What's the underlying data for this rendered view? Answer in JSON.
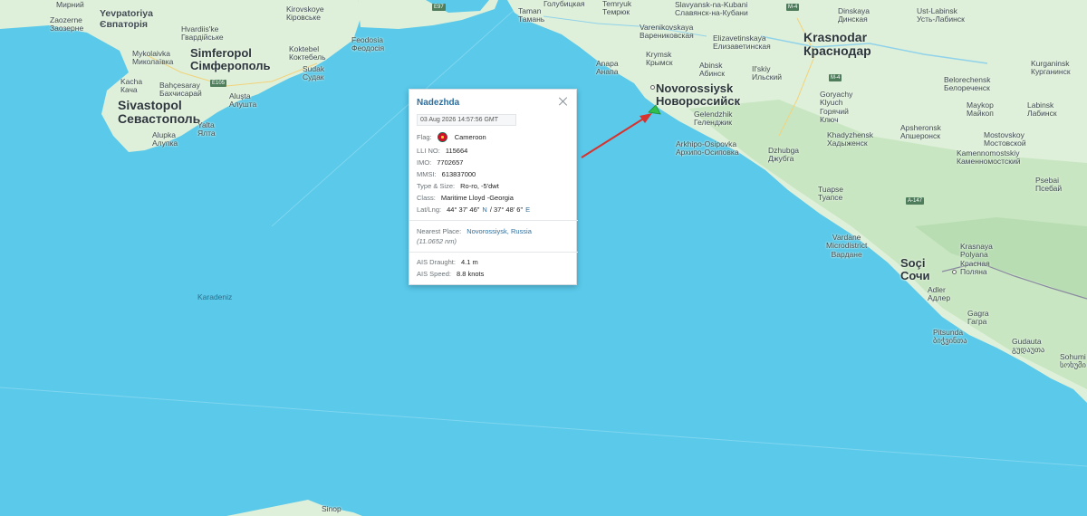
{
  "map": {
    "sea_label": "Karadeniz",
    "labels": [
      {
        "id": "zaozerne",
        "text": "Zaozerne\nЗаозерне",
        "cls": "sm"
      },
      {
        "id": "yevpatoriya",
        "text": "Yevpatoriya\nЄвпаторія",
        "cls": "md"
      },
      {
        "id": "mirnyi",
        "text": "Мирний",
        "cls": "sm"
      },
      {
        "id": "hvardiiske",
        "text": "Hvardiis'ke\nГвардійське",
        "cls": "sm"
      },
      {
        "id": "mykolaivka",
        "text": "Mykolaivka\nМиколаївка",
        "cls": "sm"
      },
      {
        "id": "simferopol",
        "text": "Simferopol\nСімферополь",
        "cls": "lg"
      },
      {
        "id": "kacha",
        "text": "Kacha\nКача",
        "cls": "sm"
      },
      {
        "id": "bahcesaray",
        "text": "Bahçesaray\nБахчисарай",
        "cls": "sm"
      },
      {
        "id": "sivastopol",
        "text": "Sivastopol\nСевастополь",
        "cls": "xl"
      },
      {
        "id": "alushta",
        "text": "Alușta\nАлушта",
        "cls": "sm"
      },
      {
        "id": "yalta",
        "text": "Yalta\nЯлта",
        "cls": "sm"
      },
      {
        "id": "alupka",
        "text": "Alupka\nАлупка",
        "cls": "sm"
      },
      {
        "id": "kirovskoye",
        "text": "Kirovskoye\nКіровське",
        "cls": "sm"
      },
      {
        "id": "koktebel",
        "text": "Koktebel\nКоктебель",
        "cls": "sm"
      },
      {
        "id": "feodosia",
        "text": "Feodosia\nФеодосія",
        "cls": "sm"
      },
      {
        "id": "sudak",
        "text": "Sudak\nСудак",
        "cls": "sm"
      },
      {
        "id": "taman",
        "text": "Taman\nТамань",
        "cls": "sm"
      },
      {
        "id": "golubitskaya",
        "text": "Голубицкая",
        "cls": "sm"
      },
      {
        "id": "temryuk",
        "text": "Temryuk\nТемрюк",
        "cls": "sm"
      },
      {
        "id": "slavyansk",
        "text": "Slavyansk-na-Kubani\nСлавянск-на-Кубани",
        "cls": "sm"
      },
      {
        "id": "varenikovskaya",
        "text": "Varenikovskaya\nВарениковская",
        "cls": "sm"
      },
      {
        "id": "krymsk",
        "text": "Krymsk\nКрымск",
        "cls": "sm"
      },
      {
        "id": "anapa",
        "text": "Anapa\nАнапа",
        "cls": "sm"
      },
      {
        "id": "abinsk",
        "text": "Abinsk\nАбинск",
        "cls": "sm"
      },
      {
        "id": "ilsky",
        "text": "Il'skiy\nИльский",
        "cls": "sm"
      },
      {
        "id": "elizavetinskaya",
        "text": "Elizavetinskaya\nЕлизаветинская",
        "cls": "sm"
      },
      {
        "id": "krasnodar",
        "text": "Krasnodar\nКраснодар",
        "cls": "xl"
      },
      {
        "id": "dinskaya",
        "text": "Dinskaya\nДинская",
        "cls": "sm"
      },
      {
        "id": "ustlabinsk",
        "text": "Ust-Labinsk\nУсть-Лабинск",
        "cls": "sm"
      },
      {
        "id": "novorossiysk",
        "text": "Novorossiysk\nНовороссийск",
        "cls": "lg"
      },
      {
        "id": "gelendzhik",
        "text": "Gelendzhik\nГеленджик",
        "cls": "sm"
      },
      {
        "id": "arkhipo",
        "text": "Arkhipo-Osipovka\nАрхипо-Осиповка",
        "cls": "sm"
      },
      {
        "id": "dzhubga",
        "text": "Dzhubga\nДжубга",
        "cls": "sm"
      },
      {
        "id": "goryachy",
        "text": "Goryachy\nKlyuch\nГорячий\nКлюч",
        "cls": "sm"
      },
      {
        "id": "beloreshensk",
        "text": "Belorechensk\nБелореченск",
        "cls": "sm"
      },
      {
        "id": "kurganinsk",
        "text": "Kurganinsk\nКурганинск",
        "cls": "sm"
      },
      {
        "id": "labinsk",
        "text": "Labinsk\nЛабинск",
        "cls": "sm"
      },
      {
        "id": "maykop",
        "text": "Маykop\nМайкоп",
        "cls": "sm"
      },
      {
        "id": "khadyzhensk",
        "text": "Khadyzhensk\nХадыженск",
        "cls": "sm"
      },
      {
        "id": "apsheronsk",
        "text": "Apsheronsk\nАпшеронск",
        "cls": "sm"
      },
      {
        "id": "mostovskoy",
        "text": "Mostovskoy\nМостовской",
        "cls": "sm"
      },
      {
        "id": "kamennomostsky",
        "text": "Kamennomostskiy\nКаменномостский",
        "cls": "sm"
      },
      {
        "id": "tuapse",
        "text": "Tuapse\nТуапсе",
        "cls": "sm"
      },
      {
        "id": "psebai",
        "text": "Psebai\nПсебай",
        "cls": "sm"
      },
      {
        "id": "vardane",
        "text": "Vardane\nMicrodistrict\nВардане",
        "cls": "sm"
      },
      {
        "id": "sochi",
        "text": "Soçi\nСочи",
        "cls": "lg"
      },
      {
        "id": "krasnaya",
        "text": "Krasnaya\nPolyana\nКрасная\nПоляна",
        "cls": "sm"
      },
      {
        "id": "adler",
        "text": "Adler\nАдлер",
        "cls": "sm"
      },
      {
        "id": "gagra",
        "text": "Gagra\nГагра",
        "cls": "sm"
      },
      {
        "id": "pitsunda",
        "text": "Pitsunda\nბიჭვინთა",
        "cls": "sm"
      },
      {
        "id": "gudauta",
        "text": "Gudauta\nგუდაუთა",
        "cls": "sm"
      },
      {
        "id": "sohumi",
        "text": "Sohumi\nსოხუმი",
        "cls": "sm"
      },
      {
        "id": "sinop",
        "text": "Sinop",
        "cls": "sm"
      }
    ],
    "road_badges": [
      "E105",
      "E97",
      "M-4",
      "M-4",
      "A-147"
    ]
  },
  "popup": {
    "title": "Nadezhda",
    "timestamp": "03 Aug 2026 14:57:56 GMT",
    "flag_label": "Flag:",
    "flag_value": "Cameroon",
    "lli_label": "LLI NO:",
    "lli_value": "115664",
    "imo_label": "IMO:",
    "imo_value": "7702657",
    "mmsi_label": "MMSI:",
    "mmsi_value": "613837000",
    "type_label": "Type & Size:",
    "type_value": "Ro-ro, -5'dwt",
    "class_label": "Class:",
    "class_value": "Maritime Lloyd -Georgia",
    "latlng_label": "Lat/Lng:",
    "lat_value": "44° 37' 46\"",
    "lat_dir": "N",
    "lng_value": "/ 37° 48' 6\"",
    "lng_dir": "E",
    "nearest_label": "Nearest Place:",
    "nearest_value": "Novorossiysk, Russia",
    "nearest_distance": "(11.0652 nm)",
    "draught_label": "AIS Draught:",
    "draught_value": "4.1 m",
    "speed_label": "AIS Speed:",
    "speed_value": "8.8 knots"
  },
  "colors": {
    "sea": "#5ac9ea",
    "land": "#dff0da",
    "arrow": "#d8322f",
    "vessel": "#2fbf4a",
    "link": "#2e6f9e"
  }
}
